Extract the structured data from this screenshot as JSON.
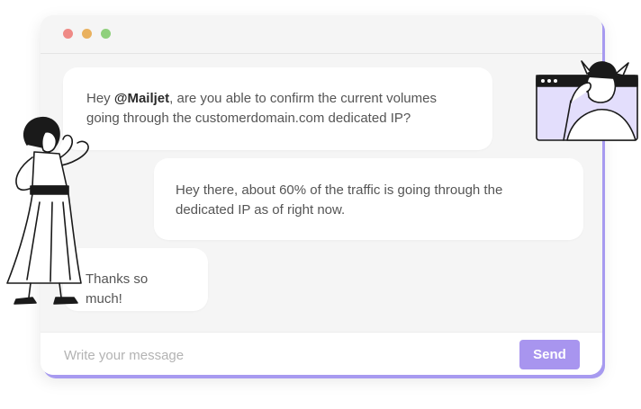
{
  "window": {
    "controls": [
      "close",
      "minimize",
      "maximize"
    ]
  },
  "messages": [
    {
      "prefix": "Hey ",
      "mention": "@Mailjet",
      "text": ", are you able to confirm the current volumes going through the customerdomain.com dedicated IP?"
    },
    {
      "text": "Hey there, about 60% of the traffic is going through the dedicated IP as of right now."
    },
    {
      "text": "Thanks so much!"
    }
  ],
  "composer": {
    "placeholder": "Write your message",
    "send_label": "Send"
  },
  "colors": {
    "accent": "#a895ef",
    "window_bg": "#f5f5f5",
    "bubble_bg": "#ffffff",
    "window_shadow": "#a79af0"
  },
  "illustrations": {
    "left": "woman-standing-hand-on-head",
    "right": "person-peeking-from-browser-window"
  }
}
